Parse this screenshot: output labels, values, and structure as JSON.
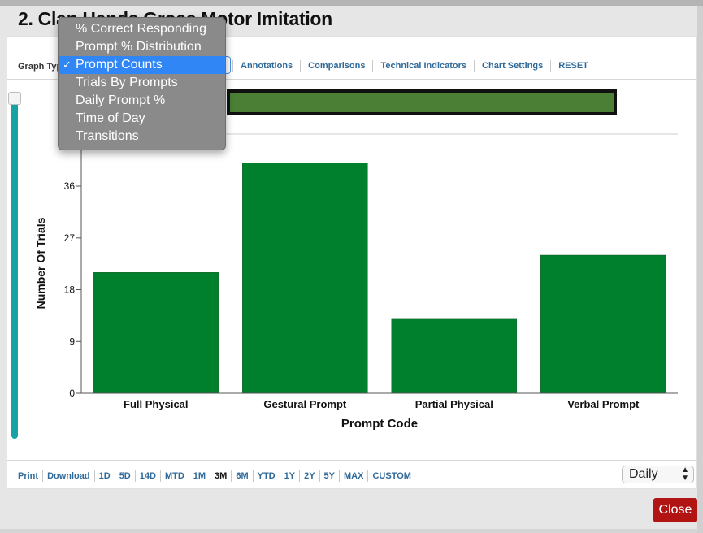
{
  "window": {
    "title": "2. Clap Hands Gross Motor Imitation"
  },
  "toolbar": {
    "graph_type_label": "Graph Type",
    "links": [
      "Annotations",
      "Comparisons",
      "Technical Indicators",
      "Chart Settings",
      "RESET"
    ]
  },
  "dropdown": {
    "items": [
      {
        "label": "% Correct Responding",
        "selected": false
      },
      {
        "label": "Prompt % Distribution",
        "selected": false
      },
      {
        "label": "Prompt Counts",
        "selected": true
      },
      {
        "label": "Trials By Prompts",
        "selected": false
      },
      {
        "label": "Daily Prompt %",
        "selected": false
      },
      {
        "label": "Time of Day",
        "selected": false
      },
      {
        "label": "Transitions",
        "selected": false
      }
    ],
    "check_glyph": "✓"
  },
  "chart_data": {
    "type": "bar",
    "categories": [
      "Full Physical",
      "Gestural Prompt",
      "Partial Physical",
      "Verbal Prompt"
    ],
    "values": [
      21,
      40,
      13,
      24
    ],
    "xlabel": "Prompt Code",
    "ylabel": "Number Of Trials",
    "yticks": [
      0,
      9,
      18,
      27,
      36
    ],
    "ylim": [
      0,
      45
    ],
    "bar_color": "#007f2d",
    "grid": false
  },
  "footer": {
    "links": [
      "Print",
      "Download",
      "1D",
      "5D",
      "14D",
      "MTD",
      "1M",
      "3M",
      "6M",
      "YTD",
      "1Y",
      "2Y",
      "5Y",
      "MAX",
      "CUSTOM"
    ],
    "active": "3M",
    "period_value": "Daily"
  },
  "buttons": {
    "close_label": "Close",
    "close_color": "#b21414"
  },
  "colors": {
    "accent": "#2f6a9a",
    "slider": "#17a2a6",
    "navigator": "#4a7f35",
    "selection": "#2f86f4"
  }
}
